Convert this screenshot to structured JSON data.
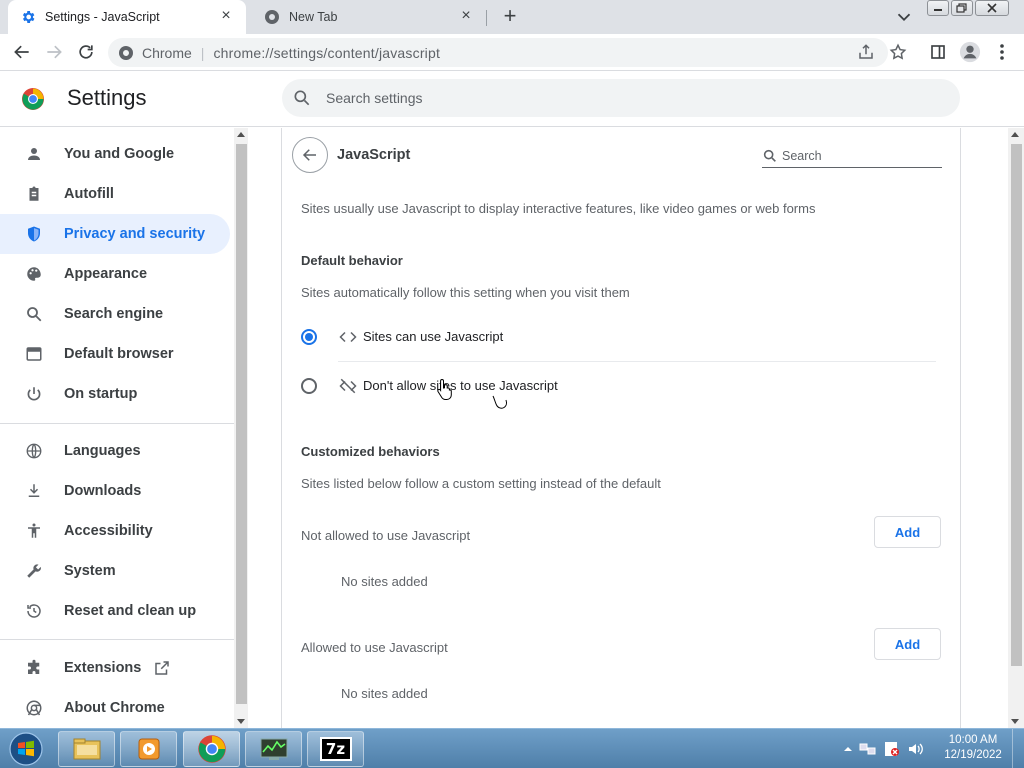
{
  "tabs": [
    {
      "title": "Settings - JavaScript",
      "close": "×",
      "icon": "gear-icon"
    },
    {
      "title": "New Tab",
      "close": "×",
      "icon": "chrome-globe-icon"
    }
  ],
  "newtab_symbol": "+",
  "omnibox": {
    "site_chip": "Chrome",
    "separator": "|",
    "url": "chrome://settings/content/javascript"
  },
  "header": {
    "title": "Settings",
    "search_placeholder": "Search settings"
  },
  "sidebar": {
    "items": [
      {
        "label": "You and Google",
        "icon": "person-icon"
      },
      {
        "label": "Autofill",
        "icon": "clipboard-icon"
      },
      {
        "label": "Privacy and security",
        "icon": "shield-icon",
        "selected": true
      },
      {
        "label": "Appearance",
        "icon": "palette-icon"
      },
      {
        "label": "Search engine",
        "icon": "search-icon"
      },
      {
        "label": "Default browser",
        "icon": "browser-window-icon"
      },
      {
        "label": "On startup",
        "icon": "power-icon"
      },
      {
        "label": "Languages",
        "icon": "globe-icon"
      },
      {
        "label": "Downloads",
        "icon": "download-icon"
      },
      {
        "label": "Accessibility",
        "icon": "accessibility-icon"
      },
      {
        "label": "System",
        "icon": "wrench-icon"
      },
      {
        "label": "Reset and clean up",
        "icon": "history-icon"
      },
      {
        "label": "Extensions",
        "icon": "puzzle-icon"
      },
      {
        "label": "About Chrome",
        "icon": "chrome-icon"
      }
    ]
  },
  "page": {
    "heading": "JavaScript",
    "search_placeholder": "Search",
    "description": "Sites usually use Javascript to display interactive features, like video games or web forms",
    "default_behavior": {
      "title": "Default behavior",
      "subtitle": "Sites automatically follow this setting when you visit them",
      "options": [
        {
          "label": "Sites can use Javascript",
          "checked": true,
          "icon": "code-icon"
        },
        {
          "label": "Don't allow sites to use Javascript",
          "checked": false,
          "icon": "code-off-icon"
        }
      ]
    },
    "customized": {
      "title": "Customized behaviors",
      "subtitle": "Sites listed below follow a custom setting instead of the default",
      "not_allowed_label": "Not allowed to use Javascript",
      "allowed_label": "Allowed to use Javascript",
      "add_label": "Add",
      "empty_label": "No sites added"
    }
  },
  "taskbar": {
    "clock_time": "10:00 AM",
    "clock_date": "12/19/2022",
    "apps": [
      "file-explorer-icon",
      "media-player-icon",
      "chrome-icon",
      "task-manager-icon",
      "7zip-icon"
    ],
    "app_7z_label": "7z"
  },
  "colors": {
    "accent": "#1a73e8",
    "selected_bg": "#e8f0fe",
    "taskbar": "#5b8bb5"
  }
}
